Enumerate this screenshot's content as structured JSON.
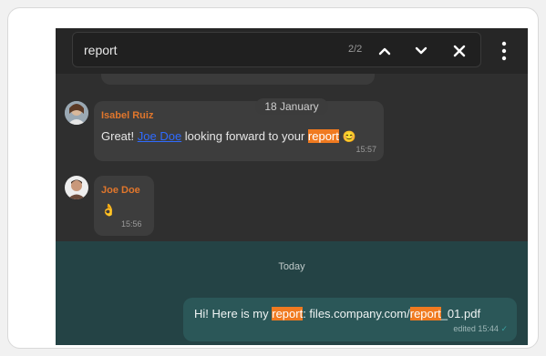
{
  "search": {
    "query": "report",
    "count": "2/2"
  },
  "icons": {
    "prev": "chevron-up-icon",
    "next": "chevron-down-icon",
    "close": "close-icon",
    "more": "more-vertical-icon"
  },
  "chat": {
    "date_separator": "18 January",
    "today_label": "Today",
    "messages": [
      {
        "sender": "Isabel Ruiz",
        "text_before": "Great! ",
        "mention": "Joe Doe",
        "text_mid": " looking forward to your ",
        "highlight": "report",
        "emoji": "😊",
        "time": "15:57"
      },
      {
        "sender": "Joe Doe",
        "emoji": "👌",
        "time": "15:56"
      },
      {
        "text_before": "Hi! Here is my ",
        "highlight1": "report",
        "text_mid": ": files.company.com/",
        "highlight2": "report",
        "text_after": "_01.pdf",
        "edited": "edited",
        "time": "15:44",
        "status": "✓"
      }
    ]
  },
  "colors": {
    "accent": "#f07a20",
    "sender": "#e0762c",
    "mention": "#2f6bff",
    "own_bubble": "#2b5758"
  }
}
